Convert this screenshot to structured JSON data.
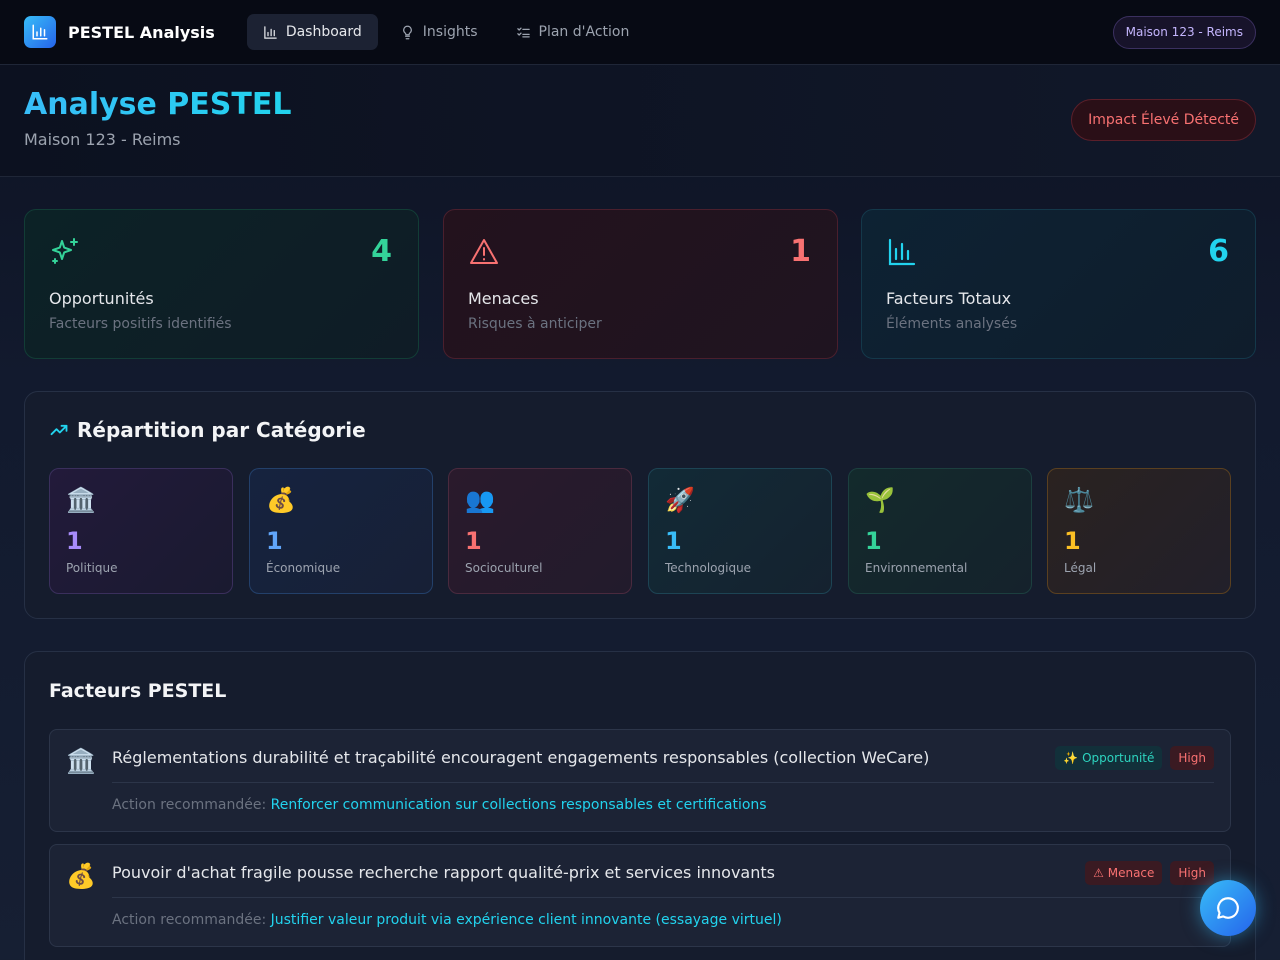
{
  "app": {
    "brand": "PESTEL Analysis"
  },
  "nav": {
    "items": [
      {
        "label": "Dashboard",
        "icon": "bar-chart-icon",
        "active": true
      },
      {
        "label": "Insights",
        "icon": "lightbulb-icon",
        "active": false
      },
      {
        "label": "Plan d'Action",
        "icon": "checklist-icon",
        "active": false
      }
    ],
    "site_badge": "Maison 123 - Reims"
  },
  "header": {
    "title": "Analyse PESTEL",
    "subtitle": "Maison 123 - Reims",
    "impact_badge": "Impact Élevé Détecté"
  },
  "stats": [
    {
      "value": "4",
      "label": "Opportunités",
      "desc": "Facteurs positifs identifiés",
      "icon": "sparkles-icon",
      "color": "#34d399"
    },
    {
      "value": "1",
      "label": "Menaces",
      "desc": "Risques à anticiper",
      "icon": "warning-icon",
      "color": "#f87171"
    },
    {
      "value": "6",
      "label": "Facteurs Totaux",
      "desc": "Éléments analysés",
      "icon": "bar-chart-icon",
      "color": "#22d3ee"
    }
  ],
  "categories": {
    "title": "Répartition par Catégorie",
    "items": [
      {
        "emoji": "🏛️",
        "count": "1",
        "label": "Politique",
        "color": "#a78bfa"
      },
      {
        "emoji": "💰",
        "count": "1",
        "label": "Économique",
        "color": "#60a5fa"
      },
      {
        "emoji": "👥",
        "count": "1",
        "label": "Socioculturel",
        "color": "#f87171"
      },
      {
        "emoji": "🚀",
        "count": "1",
        "label": "Technologique",
        "color": "#38bdf8"
      },
      {
        "emoji": "🌱",
        "count": "1",
        "label": "Environnemental",
        "color": "#34d399"
      },
      {
        "emoji": "⚖️",
        "count": "1",
        "label": "Légal",
        "color": "#fbbf24"
      }
    ]
  },
  "factors": {
    "title": "Facteurs PESTEL",
    "action_label": "Action recommandée:",
    "items": [
      {
        "emoji": "🏛️",
        "title": "Réglementations durabilité et traçabilité encouragent engagements responsables (collection WeCare)",
        "type_tag": "✨ Opportunité",
        "impact_tag": "High",
        "action": "Renforcer communication sur collections responsables et certifications"
      },
      {
        "emoji": "💰",
        "title": "Pouvoir d'achat fragile pousse recherche rapport qualité-prix et services innovants",
        "type_tag": "⚠ Menace",
        "impact_tag": "High",
        "action": "Justifier valeur produit via expérience client innovante (essayage virtuel)"
      }
    ]
  }
}
